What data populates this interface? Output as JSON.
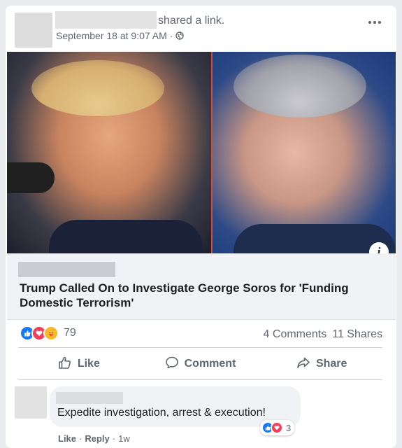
{
  "post": {
    "action_text": "shared a link.",
    "timestamp": "September 18 at 9:07 AM",
    "separator": "·",
    "privacy_icon": "globe-icon",
    "more_icon": "more-options-icon"
  },
  "link": {
    "headline": "Trump Called On to Investigate George Soros for 'Funding Domestic Terrorism'",
    "info_glyph": "i"
  },
  "stats": {
    "reaction_icons": [
      "like-icon",
      "love-icon",
      "care-icon"
    ],
    "reaction_count": "79",
    "comments": "4 Comments",
    "shares": "11 Shares"
  },
  "actions": {
    "like": "Like",
    "comment": "Comment",
    "share": "Share"
  },
  "comment": {
    "text": "Expedite investigation, arrest & execution!",
    "reaction_count": "3",
    "like": "Like",
    "dot": "·",
    "reply": "Reply",
    "age": "1w"
  },
  "colors": {
    "like_blue": "#1877f2",
    "love_red": "#f33e58",
    "care_yellow": "#f7b928",
    "secondary_text": "#606770"
  }
}
